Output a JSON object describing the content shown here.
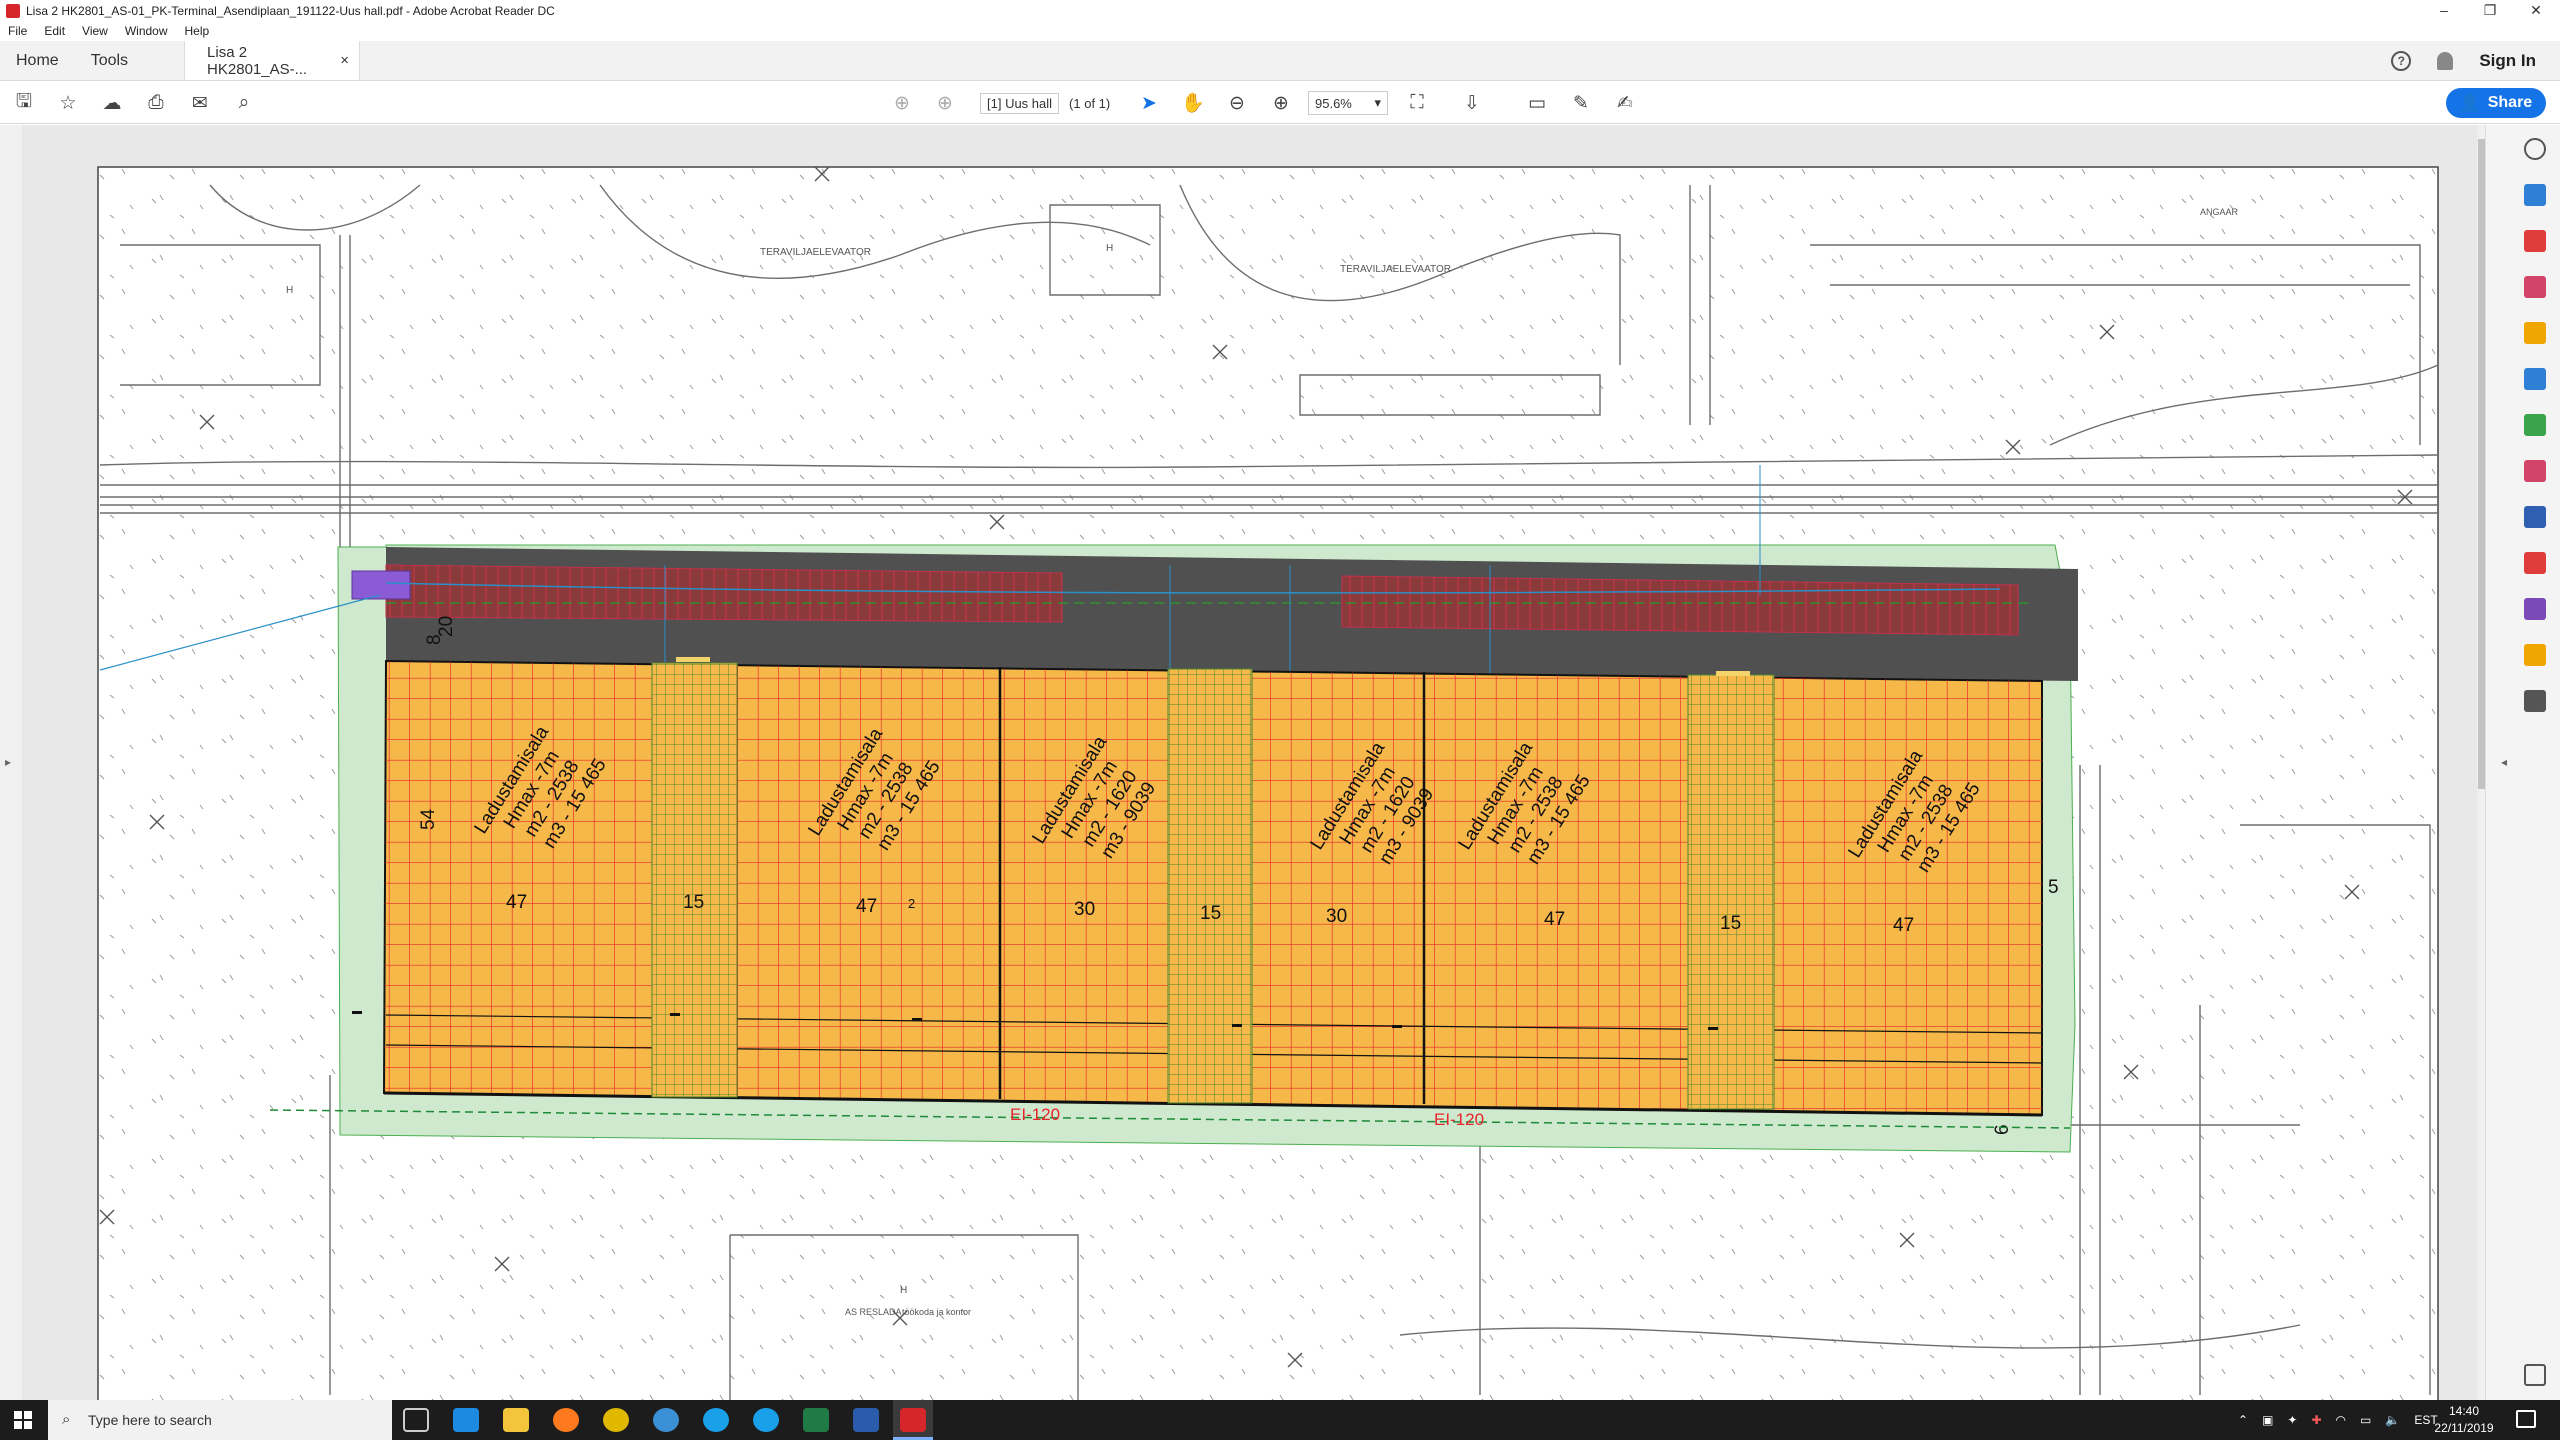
{
  "window": {
    "title": "Lisa 2 HK2801_AS-01_PK-Terminal_Asendiplaan_191122-Uus hall.pdf - Adobe Acrobat Reader DC",
    "minimize": "–",
    "restore": "❐",
    "close": "✕"
  },
  "menu": {
    "items": [
      "File",
      "Edit",
      "View",
      "Window",
      "Help"
    ]
  },
  "tabs": {
    "home": "Home",
    "tools": "Tools",
    "doc": "Lisa 2 HK2801_AS-...",
    "close": "×",
    "sign_in": "Sign In",
    "help": "?"
  },
  "toolbar": {
    "page_field": "[1] Uus hall",
    "page_count": "(1 of 1)",
    "zoom": "95.6%",
    "share": "Share"
  },
  "drawing": {
    "map_labels": {
      "teravili_left": "TERAVILJAELEVAATOR",
      "teravili_right": "TERAVILJAELEVAATOR",
      "building": "AS RESLADA",
      "building_sub": "töökoda ja kontor",
      "angaar": "ANGAAR",
      "h1": "H",
      "h2": "H",
      "h3": "H"
    },
    "dims": {
      "d8": "8",
      "d20": "20",
      "d54": "54",
      "d47a": "47",
      "d15a": "15",
      "d47b": "47",
      "d2": "2",
      "d30a": "30",
      "d15b": "15",
      "d30b": "30",
      "d47c": "47",
      "d15c": "15",
      "d47d": "47",
      "d5": "5",
      "d6": "6"
    },
    "fire_1": "EI-120",
    "fire_2": "EI-120",
    "zones": [
      {
        "name": "Ladustamisala",
        "h": "Hmax -7m",
        "m2": "m2 - 2538",
        "m3": "m3 - 15 465"
      },
      {
        "name": "Ladustamisala",
        "h": "Hmax -7m",
        "m2": "m2 - 2538",
        "m3": "m3 - 15 465"
      },
      {
        "name": "Ladustamisala",
        "h": "Hmax -7m",
        "m2": "m2 - 1620",
        "m3": "m3 - 9039"
      },
      {
        "name": "Ladustamisala",
        "h": "Hmax -7m",
        "m2": "m2 - 1620",
        "m3": "m3 - 9039"
      },
      {
        "name": "Ladustamisala",
        "h": "Hmax -7m",
        "m2": "m2 - 2538",
        "m3": "m3 - 15 465"
      },
      {
        "name": "Ladustamisala",
        "h": "Hmax -7m",
        "m2": "m2 - 2538",
        "m3": "m3 - 15 465"
      }
    ]
  },
  "taskbar": {
    "search_placeholder": "Type here to search",
    "lang": "EST",
    "time": "14:40",
    "date": "22/11/2019"
  },
  "colors": {
    "accent": "#1473e6",
    "storage_fill": "#f6b849",
    "grid_red": "#e8262b",
    "roof_dark": "#505050",
    "green_zone": "#cfe9cf"
  }
}
